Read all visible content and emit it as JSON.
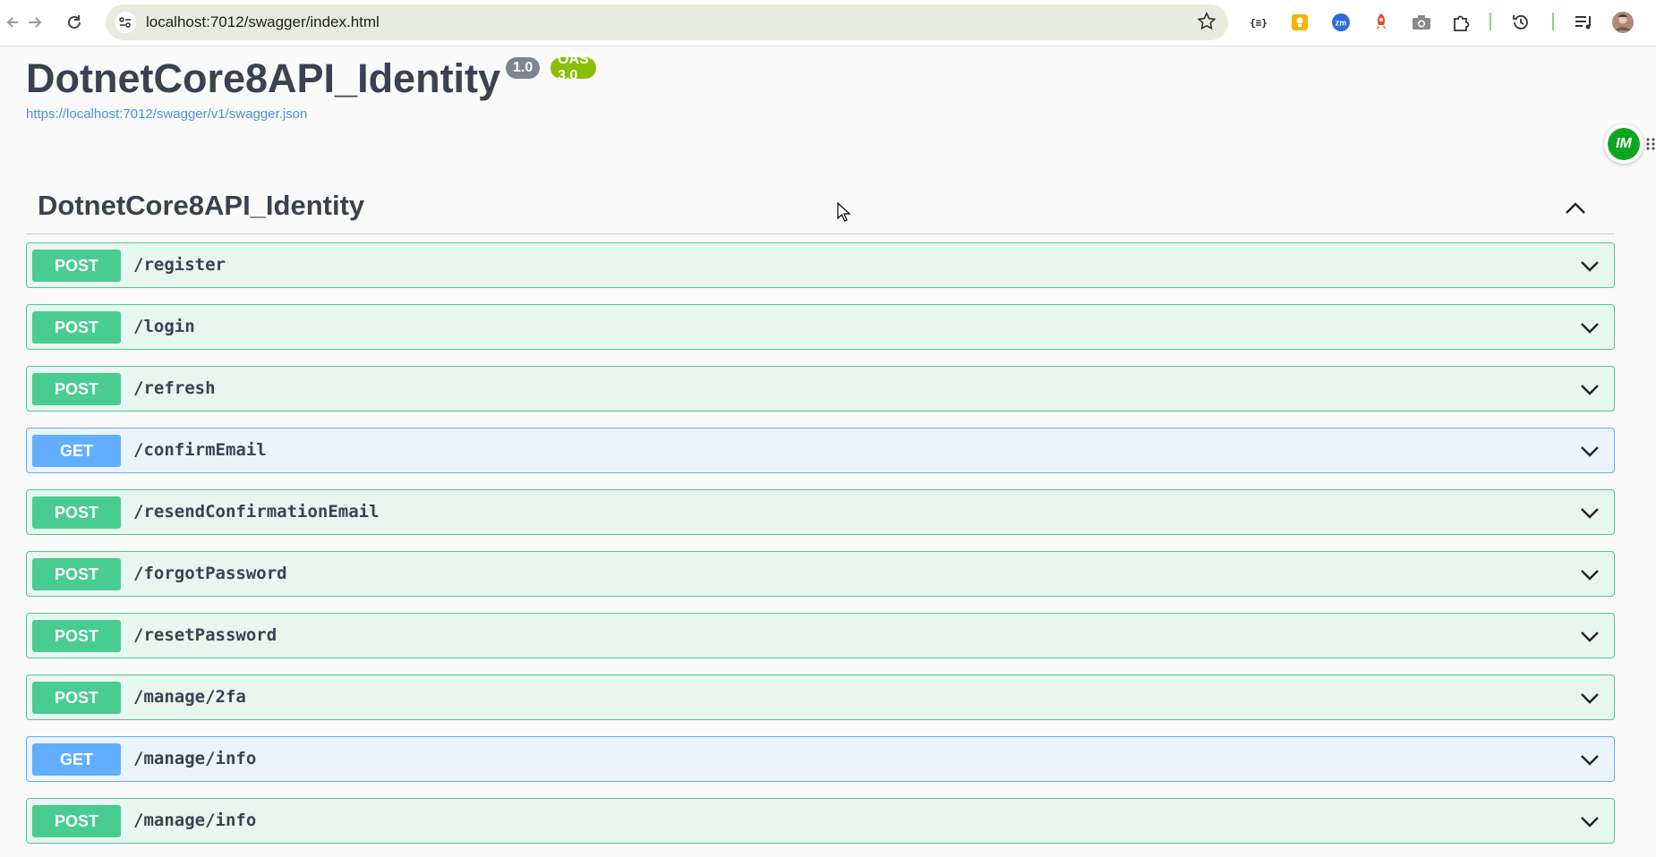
{
  "browser": {
    "url": "localhost:7012/swagger/index.html",
    "extensions": [
      "json-formatter-icon",
      "keep-notes-icon",
      "zoom-icon",
      "rocket-extension-icon",
      "camera-icon",
      "puzzle-extensions-icon"
    ],
    "accent_separator_color": "#7ed87e"
  },
  "info": {
    "title": "DotnetCore8API_Identity",
    "version_badge": "1.0",
    "oas_badge": "OAS 3.0",
    "spec_link": "https://localhost:7012/swagger/v1/swagger.json"
  },
  "widget": {
    "label": "IM"
  },
  "tag": {
    "name": "DotnetCore8API_Identity",
    "expanded": true
  },
  "operations": [
    {
      "method": "POST",
      "path": "/register"
    },
    {
      "method": "POST",
      "path": "/login"
    },
    {
      "method": "POST",
      "path": "/refresh"
    },
    {
      "method": "GET",
      "path": "/confirmEmail"
    },
    {
      "method": "POST",
      "path": "/resendConfirmationEmail"
    },
    {
      "method": "POST",
      "path": "/forgotPassword"
    },
    {
      "method": "POST",
      "path": "/resetPassword"
    },
    {
      "method": "POST",
      "path": "/manage/2fa"
    },
    {
      "method": "GET",
      "path": "/manage/info"
    },
    {
      "method": "POST",
      "path": "/manage/info"
    }
  ],
  "colors": {
    "post": "#49cc90",
    "get": "#61affe",
    "version_badge": "#7d8492",
    "oas_badge": "#89bf04",
    "link": "#4990e2"
  }
}
